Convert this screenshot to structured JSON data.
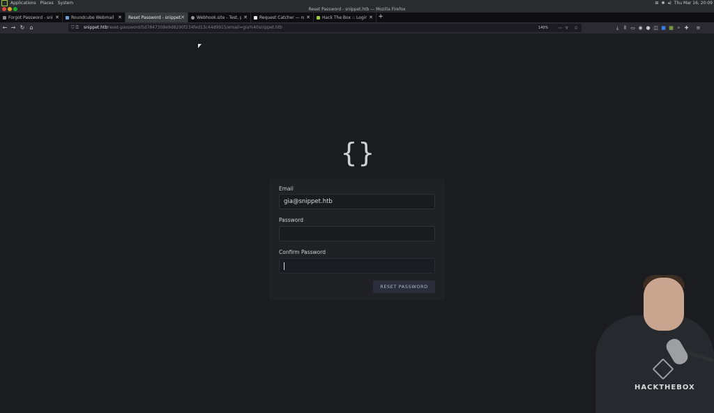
{
  "os_bar": {
    "menu": [
      "Applications",
      "Places",
      "System"
    ],
    "clock": "Thu Mar 16, 20:09"
  },
  "window": {
    "title": "Reset Password - snippet.htb — Mozilla Firefox"
  },
  "tabs": [
    {
      "label": "Forgot Password - snippet.ht"
    },
    {
      "label": "Roundcube Webmail :: In"
    },
    {
      "label": "Reset Password - snippet.htb"
    },
    {
      "label": "Webhook.site - Test, pro"
    },
    {
      "label": "Request Catcher — reque"
    },
    {
      "label": "Hack The Box :: Login"
    }
  ],
  "active_tab": 2,
  "url": {
    "host": "snippet.htb",
    "path": "/reset-password/5d7847308e9d8290f234fed13c44d9915/email=gia%40snippet.htb",
    "zoom": "140%"
  },
  "page": {
    "logo_glyph": "{}",
    "email_label": "Email",
    "email_value": "gia@snippet.htb",
    "password_label": "Password",
    "password_value": "",
    "confirm_label": "Confirm Password",
    "confirm_value": "",
    "reset_button": "RESET PASSWORD"
  },
  "webcam": {
    "brand_text": "HACKTHEBOX"
  },
  "colors": {
    "page_bg": "#1b1c1f",
    "card_bg": "#202125",
    "button_bg": "#2a2d3a"
  }
}
